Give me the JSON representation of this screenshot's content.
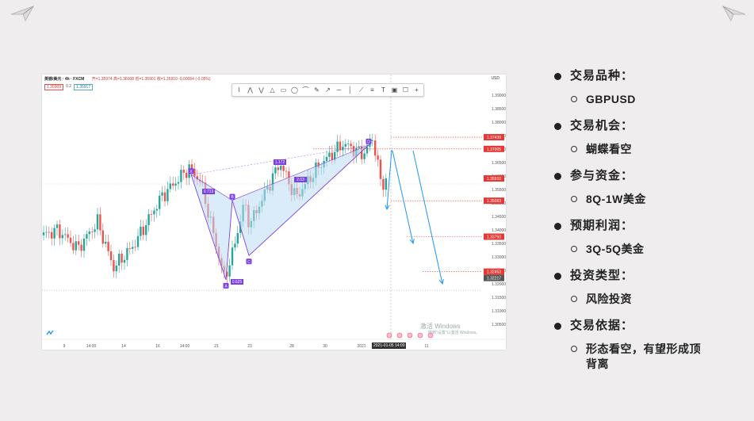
{
  "chart": {
    "symbol": "英镑/美元 · 4h · FXCM",
    "ohlc_text": "开=1.35974 高=1.36008 低=1.35901 收=1.35910 -0.00064 (-0.05%)",
    "indicator_1": "1.35909",
    "indicator_mid": "0.2",
    "indicator_2": "1.35917",
    "currency": "USD",
    "y_ticks": [
      "1.39000",
      "1.38500",
      "1.38000",
      "1.37500",
      "1.37000",
      "1.36500",
      "1.36000",
      "1.35500",
      "1.35000",
      "1.34500",
      "1.34000",
      "1.33500",
      "1.33000",
      "1.32500",
      "1.32000",
      "1.31500",
      "1.31000",
      "1.30500"
    ],
    "x_ticks": [
      "9",
      "14:00",
      "14",
      "16",
      "14:00",
      "21",
      "23",
      "28",
      "30",
      "2021",
      "14:00",
      "11"
    ],
    "highlighted_date": "2021-01-05  14:00",
    "price_tags": [
      {
        "label": "1.37439",
        "color": "#e53935"
      },
      {
        "label": "1.37005",
        "color": "#e53935"
      },
      {
        "label": "1.35910",
        "color": "#e53935"
      },
      {
        "label": "1.35083",
        "color": "#e53935"
      },
      {
        "label": "1.33750",
        "color": "#e53935"
      },
      {
        "label": "1.32453",
        "color": "#e53935"
      },
      {
        "label": "1.32217",
        "color": "#555555"
      }
    ],
    "pattern_labels": {
      "x": "X",
      "a": "A",
      "b": "B",
      "c": "C",
      "d": "D"
    },
    "ratios": {
      "xb": "0.713",
      "ac": "0.625",
      "bd": "2.03",
      "xd": "1.172"
    },
    "watermark": "激活 Windows",
    "watermark_sub": "转到\"设置\"以激活 Windows。",
    "colors": {
      "up": "#26a69a",
      "down": "#ef5350",
      "pattern": "#7b3fe4",
      "fill": "#bcdcf5",
      "arrow": "#2196f3"
    }
  },
  "toolbar_icons": [
    "pattern-icon",
    "xabcd-icon",
    "abcd-icon",
    "triangle-icon",
    "rectangle-icon",
    "ellipse-icon",
    "path-icon",
    "brush-icon",
    "arrow-icon",
    "horizontal-line-icon",
    "vertical-line-icon",
    "trend-icon",
    "fib-icon",
    "text-icon",
    "image-icon",
    "note-icon",
    "cross-icon"
  ],
  "info": [
    {
      "title": "交易品种：",
      "value": "GBPUSD"
    },
    {
      "title": "交易机会：",
      "value": "蝴蝶看空"
    },
    {
      "title": "参与资金：",
      "value": "8Q-1W美金"
    },
    {
      "title": "预期利润：",
      "value": "3Q-5Q美金"
    },
    {
      "title": "投资类型：",
      "value": "风险投资"
    },
    {
      "title": "交易依据：",
      "value": "形态看空，有望形成顶背离"
    }
  ]
}
